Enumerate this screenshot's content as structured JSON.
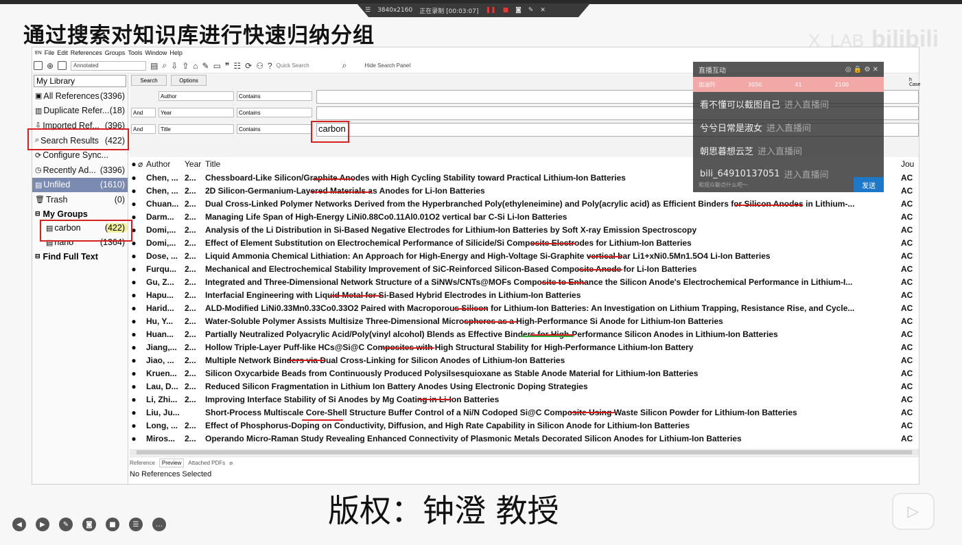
{
  "recorder": {
    "resolution": "3840x2160",
    "status": "正在录制 [00:03:07]"
  },
  "slide_title": "通过搜索对知识库进行快速归纳分组",
  "watermark": {
    "lab": "X_LAB",
    "brand": "bilibili"
  },
  "menu": [
    "File",
    "Edit",
    "References",
    "Groups",
    "Tools",
    "Window",
    "Help"
  ],
  "toolbar": {
    "style": "Annotated",
    "quick_search": "Quick Search",
    "hide_panel": "Hide Search Panel"
  },
  "library": {
    "selector": "My Library",
    "items": [
      {
        "label": "All References",
        "count": "(3396)"
      },
      {
        "label": "Duplicate Refer...",
        "count": "(18)"
      },
      {
        "label": "Imported Ref...",
        "count": "(396)"
      },
      {
        "label": "Search Results",
        "count": "(422)"
      },
      {
        "label": "Configure Sync...",
        "count": ""
      },
      {
        "label": "Recently Ad...",
        "count": "(3396)"
      },
      {
        "label": "Unfiled",
        "count": "(1610)"
      },
      {
        "label": "Trash",
        "count": "(0)"
      }
    ],
    "my_groups": "My Groups",
    "groups": [
      {
        "label": "carbon",
        "count": "(422)"
      },
      {
        "label": "nano",
        "count": "(1364)"
      }
    ],
    "find_full_text": "Find Full Text"
  },
  "search": {
    "search_btn": "Search",
    "options_btn": "Options",
    "rows": [
      {
        "bool": "",
        "field": "Author",
        "op": "Contains",
        "value": ""
      },
      {
        "bool": "And",
        "field": "Year",
        "op": "Contains",
        "value": ""
      },
      {
        "bool": "And",
        "field": "Title",
        "op": "Contains",
        "value": "carbon"
      }
    ],
    "match_case": "h Case"
  },
  "table": {
    "headers": {
      "author": "Author",
      "year": "Year",
      "title": "Title",
      "journal": "Jou"
    },
    "rows": [
      {
        "author": "Chen, ...",
        "year": "2...",
        "title": "Chessboard-Like Silicon/Graphite Anodes with High Cycling Stability toward Practical Lithium-Ion Batteries",
        "journal": "AC"
      },
      {
        "author": "Chen, ...",
        "year": "2...",
        "title": "2D Silicon-Germanium-Layered Materials as Anodes for Li-Ion Batteries",
        "journal": "AC"
      },
      {
        "author": "Chuan...",
        "year": "2...",
        "title": "Dual Cross-Linked Polymer Networks Derived from the Hyperbranched Poly(ethyleneimine) and Poly(acrylic acid) as Efficient Binders for Silicon Anodes in Lithium-...",
        "journal": "AC"
      },
      {
        "author": "Darm...",
        "year": "2...",
        "title": "Managing Life Span of High-Energy LiNi0.88Co0.11Al0.01O2 vertical bar C-Si Li-Ion Batteries",
        "journal": "AC"
      },
      {
        "author": "Domi,...",
        "year": "2...",
        "title": "Analysis of the Li Distribution in Si-Based Negative Electrodes for Lithium-Ion Batteries by Soft X-ray Emission Spectroscopy",
        "journal": "AC"
      },
      {
        "author": "Domi,...",
        "year": "2...",
        "title": "Effect of Element Substitution on Electrochemical Performance of Silicide/Si Composite Electrodes for Lithium-Ion Batteries",
        "journal": "AC"
      },
      {
        "author": "Dose, ...",
        "year": "2...",
        "title": "Liquid Ammonia Chemical Lithiation: An Approach for High-Energy and High-Voltage Si-Graphite vertical bar Li1+xNi0.5Mn1.5O4 Li-Ion Batteries",
        "journal": "AC"
      },
      {
        "author": "Furqu...",
        "year": "2...",
        "title": "Mechanical and Electrochemical Stability Improvement of SiC-Reinforced Silicon-Based Composite Anode for Li-Ion Batteries",
        "journal": "AC"
      },
      {
        "author": "Gu, Z...",
        "year": "2...",
        "title": "Integrated and Three-Dimensional Network Structure of a SiNWs/CNTs@MOFs Composite to Enhance the Silicon Anode's Electrochemical Performance in Lithium-I...",
        "journal": "AC"
      },
      {
        "author": "Hapu...",
        "year": "2...",
        "title": "Interfacial Engineering with Liquid Metal for Si-Based Hybrid Electrodes in Lithium-Ion Batteries",
        "journal": "AC"
      },
      {
        "author": "Harid...",
        "year": "2...",
        "title": "ALD-Modified LiNi0.33Mn0.33Co0.33O2 Paired with Macroporous Silicon for Lithium-Ion Batteries: An Investigation on Lithium Trapping, Resistance Rise, and Cycle...",
        "journal": "AC"
      },
      {
        "author": "Hu, Y...",
        "year": "2...",
        "title": "Water-Soluble Polymer Assists Multisize Three-Dimensional Microspheres as a High-Performance Si Anode for Lithium-Ion Batteries",
        "journal": "AC"
      },
      {
        "author": "Huan...",
        "year": "2...",
        "title": "Partially Neutralized Polyacrylic Acid/Poly(vinyl alcohol) Blends as Effective Binders for High-Performance Silicon Anodes in Lithium-Ion Batteries",
        "journal": "AC"
      },
      {
        "author": "Jiang,...",
        "year": "2...",
        "title": "Hollow Triple-Layer Puff-like HCs@Si@C Composites with High Structural Stability for High-Performance Lithium-Ion Battery",
        "journal": "AC"
      },
      {
        "author": "Jiao, ...",
        "year": "2...",
        "title": "Multiple Network Binders via Dual Cross-Linking for Silicon Anodes of Lithium-Ion Batteries",
        "journal": "AC"
      },
      {
        "author": "Kruen...",
        "year": "2...",
        "title": "Silicon Oxycarbide Beads from Continuously Produced Polysilsesquioxane as Stable Anode Material for Lithium-Ion Batteries",
        "journal": "AC"
      },
      {
        "author": "Lau, D...",
        "year": "2...",
        "title": "Reduced Silicon Fragmentation in Lithium Ion Battery Anodes Using Electronic Doping Strategies",
        "journal": "AC"
      },
      {
        "author": "Li, Zhi...",
        "year": "2...",
        "title": "Improving Interface Stability of Si Anodes by Mg Coating in Li-Ion Batteries",
        "journal": "AC"
      },
      {
        "author": "Liu, Ju...",
        "year": "",
        "title": "Short-Process Multiscale Core-Shell Structure Buffer Control of a Ni/N Codoped Si@C Composite Using Waste Silicon Powder for Lithium-Ion Batteries",
        "journal": "AC"
      },
      {
        "author": "Long, ...",
        "year": "2...",
        "title": "Effect of Phosphorus-Doping on Conductivity, Diffusion, and High Rate Capability in Silicon Anode for Lithium-Ion Batteries",
        "journal": "AC"
      },
      {
        "author": "Miros...",
        "year": "2...",
        "title": "Operando Micro-Raman Study Revealing Enhanced Connectivity of Plasmonic Metals Decorated Silicon Anodes for Lithium-Ion Batteries",
        "journal": "AC"
      }
    ]
  },
  "bottom_tabs": [
    "Reference",
    "Preview",
    "Attached PDFs"
  ],
  "no_refs": "No References Selected",
  "chat": {
    "title": "直播互动",
    "stats_label": "加油列",
    "stats": [
      "3050",
      "41",
      "2100"
    ],
    "messages": [
      {
        "name": "看不懂可以截图自己",
        "sub": "进入直播间"
      },
      {
        "name": "兮兮日常是淑女",
        "sub": "进入直播间"
      },
      {
        "name": "朝思暮想云芝",
        "sub": "进入直播间"
      },
      {
        "name": "bili_64910137051",
        "sub": "进入直播间"
      }
    ],
    "input_placeholder": "和观众聊点什么吧～",
    "send": "发送"
  },
  "copyright": "版权：钟澄 教授"
}
